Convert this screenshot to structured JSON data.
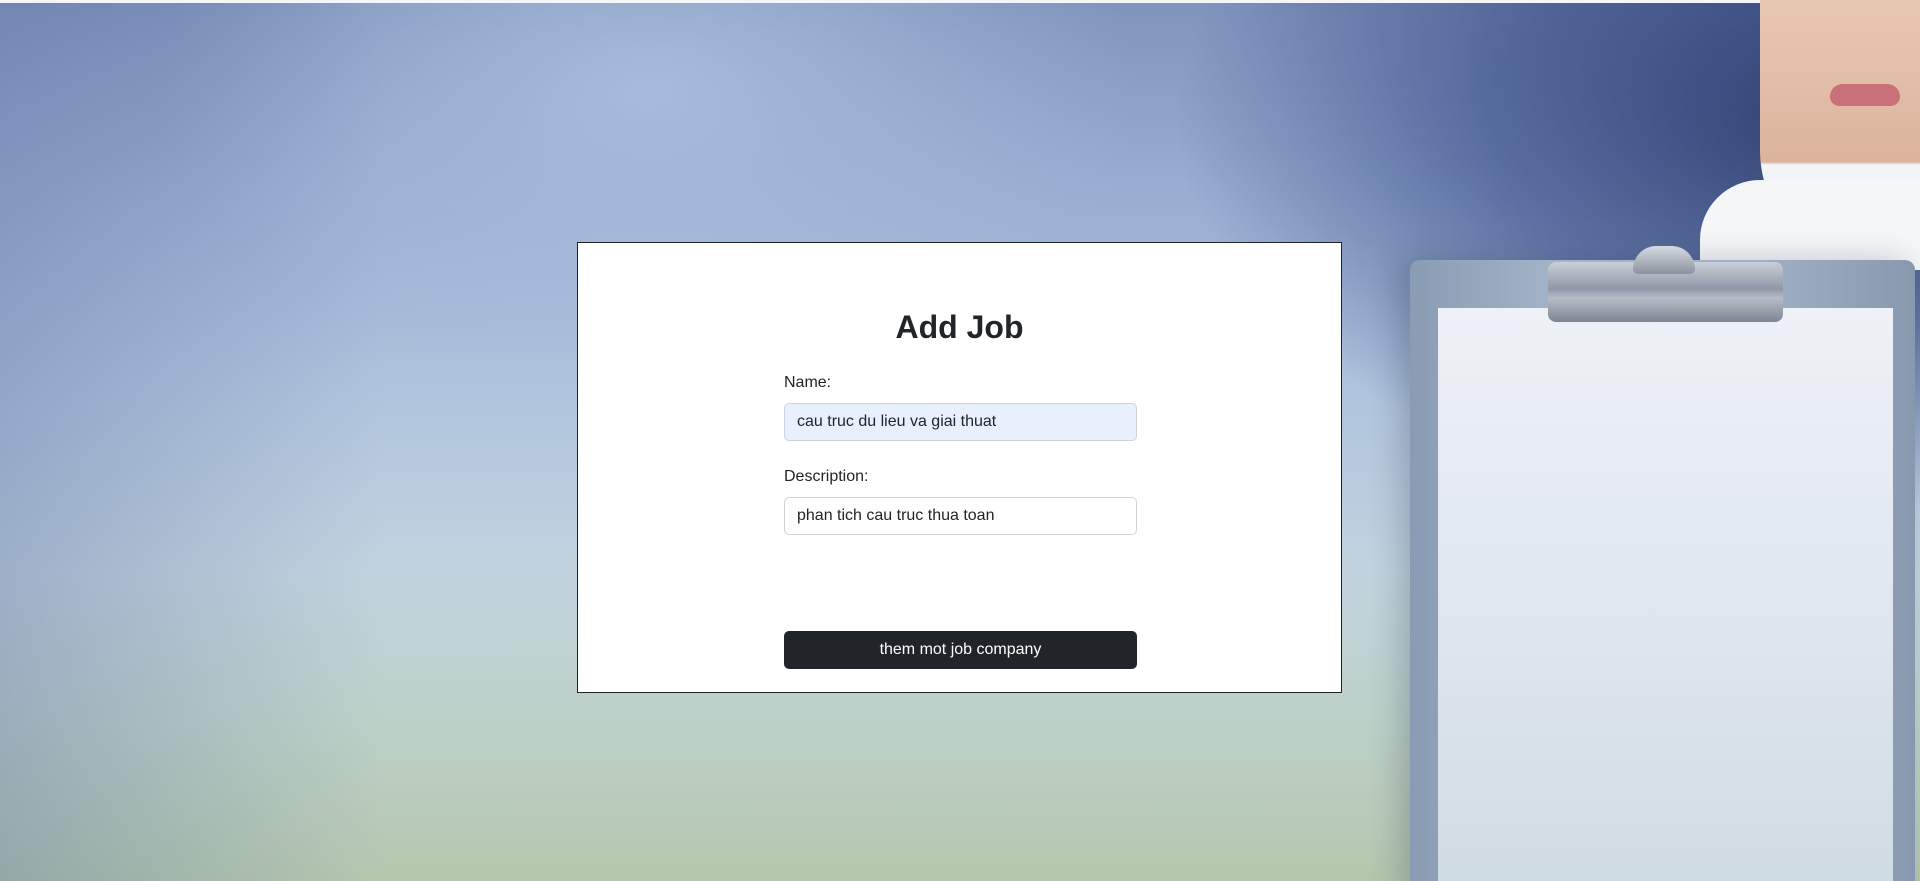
{
  "form": {
    "title": "Add Job",
    "name_label": "Name:",
    "name_value": "cau truc du lieu va giai thuat",
    "description_label": "Description:",
    "description_value": "phan tich cau truc thua toan",
    "submit_label": "them mot job company"
  },
  "colors": {
    "button_background": "#212529",
    "name_input_background": "#e8f0fe",
    "card_background": "#ffffff"
  }
}
